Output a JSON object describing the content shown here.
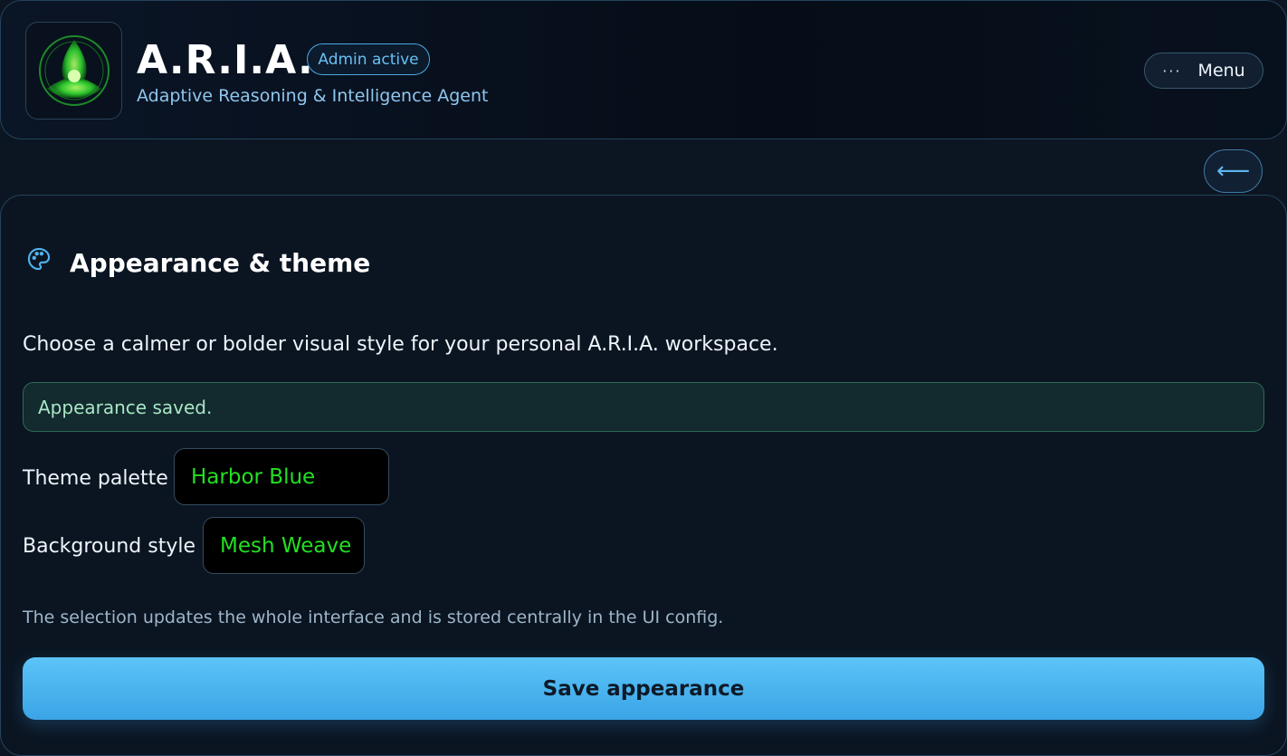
{
  "header": {
    "title": "A.R.I.A.",
    "badge": "Admin active",
    "subtitle": "Adaptive Reasoning & Intelligence Agent",
    "menu_dots": "···",
    "menu_label": "Menu",
    "logo_icon": "aria-triquetra-logo"
  },
  "nav": {
    "back_arrow": "⟵"
  },
  "appearance": {
    "icon": "palette-icon",
    "title": "Appearance & theme",
    "description": "Choose a calmer or bolder visual style for your personal A.R.I.A. workspace.",
    "status": "Appearance saved.",
    "theme_label": "Theme palette",
    "theme_value": "Harbor Blue",
    "background_label": "Background style",
    "background_value": "Mesh Weave",
    "hint": "The selection updates the whole interface and is stored centrally in the UI config.",
    "save_label": "Save appearance"
  },
  "colors": {
    "accent": "#5cc4f8",
    "select_text": "#22e022",
    "success_text": "#a9e6c6",
    "background": "#0c1522"
  }
}
